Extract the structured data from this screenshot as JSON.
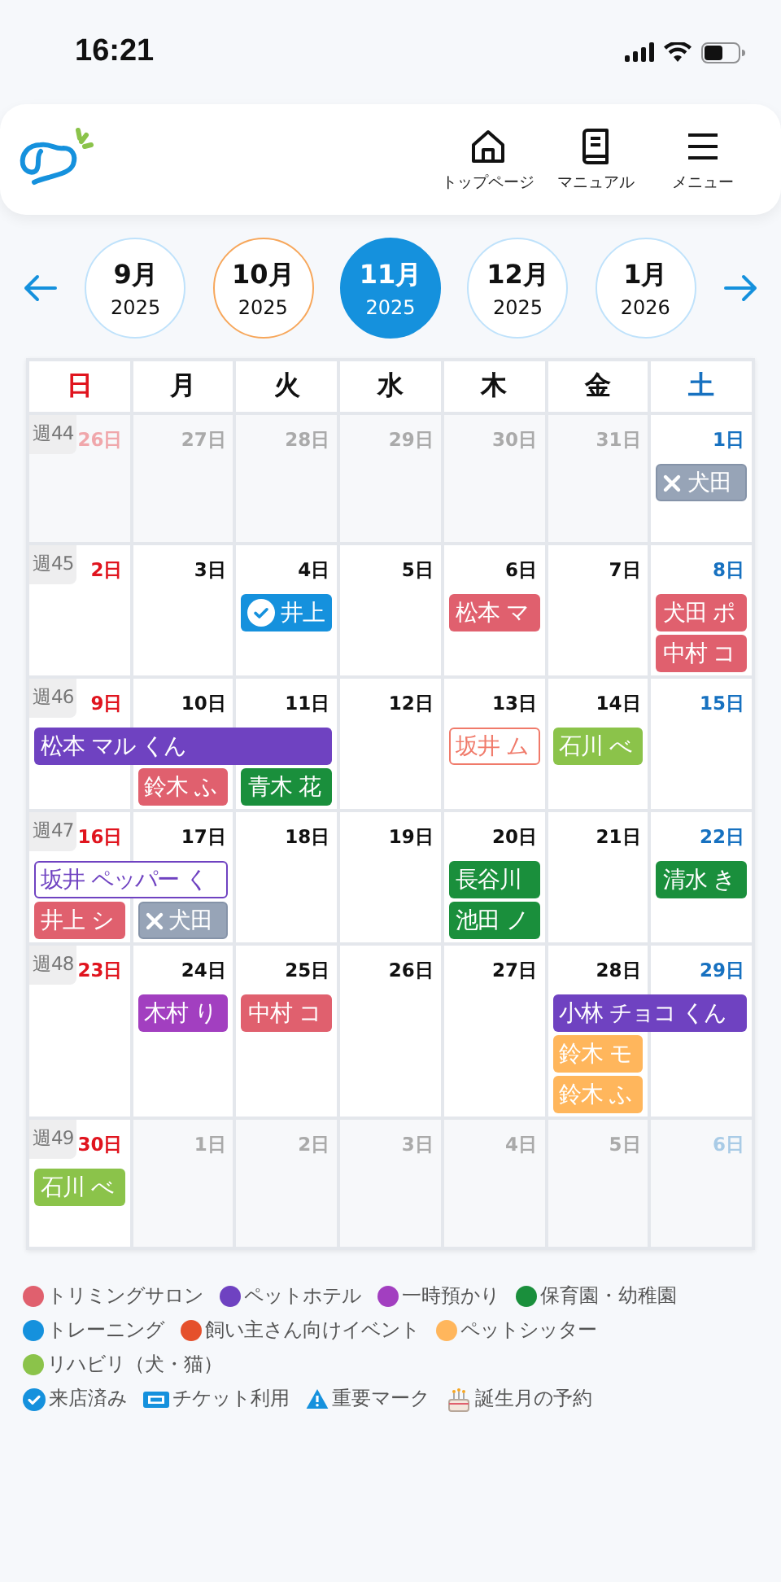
{
  "status_bar": {
    "time": "16:21"
  },
  "header": {
    "nav": [
      {
        "label": "トップページ",
        "kind": "home"
      },
      {
        "label": "マニュアル",
        "kind": "book"
      },
      {
        "label": "メニュー",
        "kind": "menu"
      }
    ]
  },
  "months": [
    {
      "month": "9月",
      "year": "2025",
      "selected": false,
      "current": false
    },
    {
      "month": "10月",
      "year": "2025",
      "selected": false,
      "current": true
    },
    {
      "month": "11月",
      "year": "2025",
      "selected": true,
      "current": false
    },
    {
      "month": "12月",
      "year": "2025",
      "selected": false,
      "current": false
    },
    {
      "month": "1月",
      "year": "2026",
      "selected": false,
      "current": false
    }
  ],
  "weekdays": [
    "日",
    "月",
    "火",
    "水",
    "木",
    "金",
    "土"
  ],
  "weeks": [
    {
      "label": "週44",
      "days": [
        {
          "text": "26日",
          "outside": true
        },
        {
          "text": "27日",
          "outside": true
        },
        {
          "text": "28日",
          "outside": true
        },
        {
          "text": "29日",
          "outside": true
        },
        {
          "text": "30日",
          "outside": true
        },
        {
          "text": "31日",
          "outside": true
        },
        {
          "text": "1日",
          "outside": false,
          "events": [
            {
              "kind": "cancelled",
              "text": "犬田",
              "color": "#97a4b7",
              "visited": false
            }
          ]
        }
      ]
    },
    {
      "label": "週45",
      "days": [
        {
          "text": "2日",
          "outside": false
        },
        {
          "text": "3日",
          "outside": false
        },
        {
          "text": "4日",
          "outside": false,
          "events": [
            {
              "kind": "booking",
              "text": "井上",
              "color": "#1591dd",
              "visited": true
            }
          ]
        },
        {
          "text": "5日",
          "outside": false
        },
        {
          "text": "6日",
          "outside": false,
          "events": [
            {
              "kind": "booking",
              "text": "松本 マ",
              "color": "#e0606e",
              "visited": false
            }
          ]
        },
        {
          "text": "7日",
          "outside": false
        },
        {
          "text": "8日",
          "outside": false,
          "events": [
            {
              "kind": "booking",
              "text": "犬田 ポ",
              "color": "#e0606e",
              "visited": false
            },
            {
              "kind": "booking",
              "text": "中村 コ",
              "color": "#e0606e",
              "visited": false
            }
          ]
        }
      ]
    },
    {
      "label": "週46",
      "days": [
        {
          "text": "9日",
          "outside": false,
          "events": [
            {
              "kind": "booking",
              "text": "松本 マル くん",
              "color": "#6f42c1",
              "visited": false
            }
          ]
        },
        {
          "text": "10日",
          "outside": false,
          "events": [
            {
              "kind": "continued"
            },
            {
              "kind": "booking",
              "text": "鈴木 ふ",
              "color": "#e0606e",
              "visited": false
            }
          ]
        },
        {
          "text": "11日",
          "outside": false,
          "events": [
            {
              "kind": "continued"
            },
            {
              "kind": "booking",
              "text": "青木 花",
              "color": "#1a8f3c",
              "visited": false
            }
          ]
        },
        {
          "text": "12日",
          "outside": false
        },
        {
          "text": "13日",
          "outside": false,
          "events": [
            {
              "kind": "tentative",
              "text": "坂井 ム",
              "color": "#f07a6a",
              "visited": false
            }
          ]
        },
        {
          "text": "14日",
          "outside": false,
          "events": [
            {
              "kind": "booking",
              "text": "石川 べ",
              "color": "#8bc34a",
              "visited": false
            }
          ]
        },
        {
          "text": "15日",
          "outside": false
        }
      ]
    },
    {
      "label": "週47",
      "days": [
        {
          "text": "16日",
          "outside": false,
          "events": [
            {
              "kind": "tentative",
              "text": "坂井 ペッパー く",
              "color": "#6f42c1",
              "visited": false
            },
            {
              "kind": "booking",
              "text": "井上 シ",
              "color": "#e0606e",
              "visited": false
            }
          ]
        },
        {
          "text": "17日",
          "outside": false,
          "events": [
            {
              "kind": "continued"
            },
            {
              "kind": "cancelled",
              "text": "犬田",
              "color": "#97a4b7",
              "visited": false
            }
          ]
        },
        {
          "text": "18日",
          "outside": false
        },
        {
          "text": "19日",
          "outside": false
        },
        {
          "text": "20日",
          "outside": false,
          "events": [
            {
              "kind": "booking",
              "text": "長谷川",
              "color": "#1a8f3c",
              "visited": false
            },
            {
              "kind": "booking",
              "text": "池田 ノ",
              "color": "#1a8f3c",
              "visited": false
            }
          ]
        },
        {
          "text": "21日",
          "outside": false
        },
        {
          "text": "22日",
          "outside": false,
          "events": [
            {
              "kind": "booking",
              "text": "清水 き",
              "color": "#1a8f3c",
              "visited": false
            }
          ]
        }
      ]
    },
    {
      "label": "週48",
      "days": [
        {
          "text": "23日",
          "outside": false
        },
        {
          "text": "24日",
          "outside": false,
          "events": [
            {
              "kind": "booking",
              "text": "木村 り",
              "color": "#a23fc0",
              "visited": false
            }
          ]
        },
        {
          "text": "25日",
          "outside": false,
          "events": [
            {
              "kind": "booking",
              "text": "中村 コ",
              "color": "#e0606e",
              "visited": false
            }
          ]
        },
        {
          "text": "26日",
          "outside": false
        },
        {
          "text": "27日",
          "outside": false
        },
        {
          "text": "28日",
          "outside": false,
          "events": [
            {
              "kind": "booking",
              "text": "小林 チョコ くん",
              "color": "#6f42c1",
              "visited": false
            },
            {
              "kind": "booking",
              "text": "鈴木 モ",
              "color": "#ffb65c",
              "visited": false
            },
            {
              "kind": "booking",
              "text": "鈴木 ふ",
              "color": "#ffb65c",
              "visited": false
            }
          ]
        },
        {
          "text": "29日",
          "outside": false,
          "events": [
            {
              "kind": "continued"
            }
          ]
        }
      ]
    },
    {
      "label": "週49",
      "days": [
        {
          "text": "30日",
          "outside": false,
          "events": [
            {
              "kind": "booking",
              "text": "石川 べ",
              "color": "#8bc34a",
              "visited": false
            }
          ]
        },
        {
          "text": "1日",
          "outside": true
        },
        {
          "text": "2日",
          "outside": true
        },
        {
          "text": "3日",
          "outside": true
        },
        {
          "text": "4日",
          "outside": true
        },
        {
          "text": "5日",
          "outside": true
        },
        {
          "text": "6日",
          "outside": true
        }
      ]
    }
  ],
  "legend": {
    "categories": [
      {
        "label": "トリミングサロン",
        "color": "#e0606e"
      },
      {
        "label": "ペットホテル",
        "color": "#6f42c1"
      },
      {
        "label": "一時預かり",
        "color": "#a23fc0"
      },
      {
        "label": "保育園・幼稚園",
        "color": "#1a8f3c"
      },
      {
        "label": "トレーニング",
        "color": "#1591dd"
      },
      {
        "label": "飼い主さん向けイベント",
        "color": "#e5502c"
      },
      {
        "label": "ペットシッター",
        "color": "#ffb65c"
      },
      {
        "label": "リハビリ（犬・猫）",
        "color": "#8bc34a"
      }
    ],
    "marks": [
      {
        "label": "来店済み",
        "kind": "check"
      },
      {
        "label": "チケット利用",
        "kind": "ticket"
      },
      {
        "label": "重要マーク",
        "kind": "warning"
      },
      {
        "label": "誕生月の予約",
        "kind": "cake"
      }
    ]
  }
}
